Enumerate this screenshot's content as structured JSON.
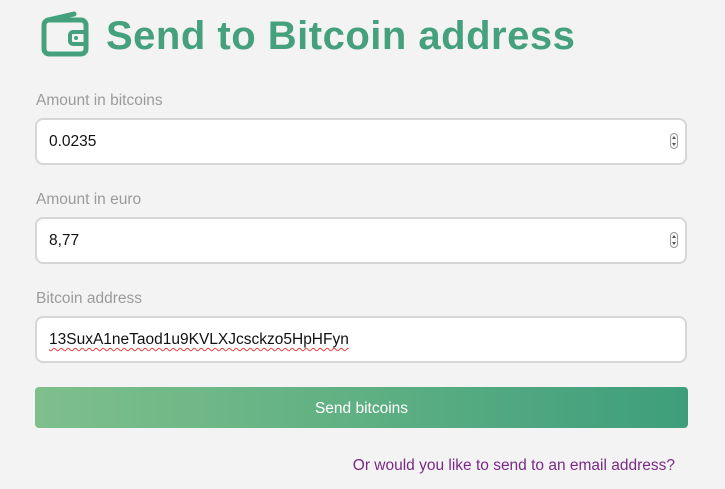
{
  "header": {
    "title": "Send to Bitcoin address",
    "icon": "wallet-icon"
  },
  "form": {
    "amount_btc": {
      "label": "Amount in bitcoins",
      "value": "0.0235"
    },
    "amount_eur": {
      "label": "Amount in euro",
      "value": "8,77"
    },
    "address": {
      "label": "Bitcoin address",
      "value": "13SuxA1neTaod1u9KVLXJcsckzo5HpHFyn"
    },
    "submit_label": "Send bitcoins"
  },
  "footer": {
    "email_link": "Or would you like to send to an email address?"
  },
  "colors": {
    "brand": "#45a07d",
    "link": "#7a2a86"
  }
}
